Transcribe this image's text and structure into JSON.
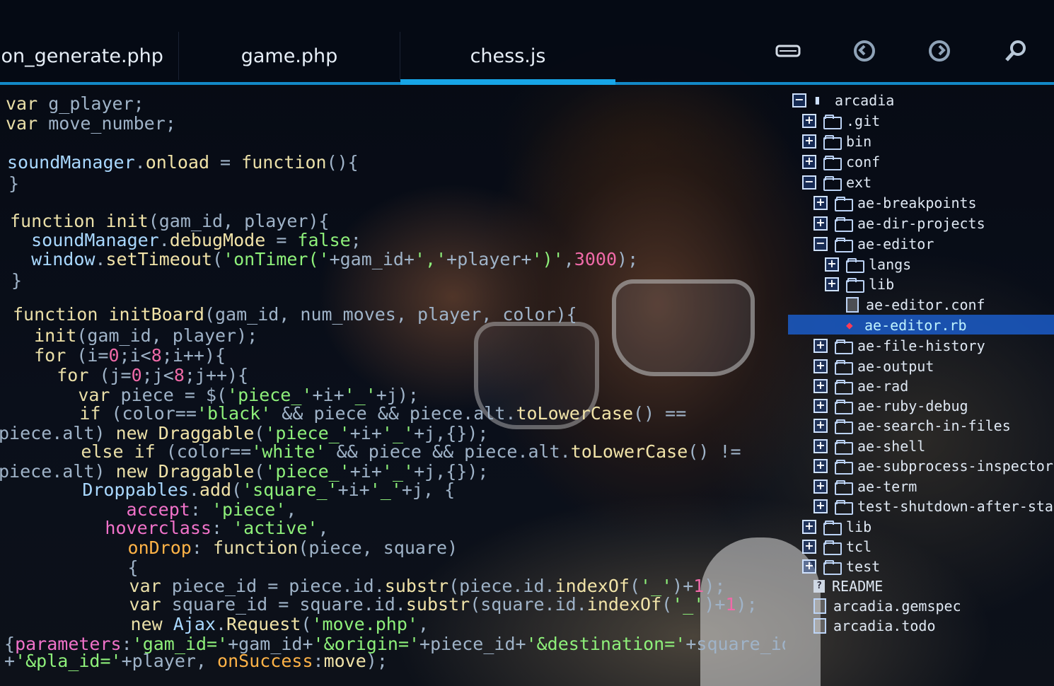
{
  "tabs": [
    "ion_generate.php",
    "game.php",
    "chess.js"
  ],
  "active_tab": "chess.js",
  "toolbar": {
    "icons": [
      "drive-icon",
      "undo-icon",
      "redo-icon",
      "search-icon"
    ]
  },
  "colors": {
    "accent": "#17a5e6",
    "selection": "#1b5cc8"
  },
  "code_lines": [
    [
      [
        "kw",
        "var "
      ],
      [
        "pl",
        "g_player;"
      ]
    ],
    [
      [
        "kw",
        "var "
      ],
      [
        "pl",
        "move_number;"
      ]
    ],
    [],
    [
      [
        "ob",
        "soundManager"
      ],
      [
        "pl",
        "."
      ],
      [
        "fn",
        "onload"
      ],
      [
        "pl",
        " = "
      ],
      [
        "kw",
        "function"
      ],
      [
        "pl",
        "(){"
      ]
    ],
    [
      [
        "pl",
        "}"
      ]
    ],
    [],
    [
      [
        "kw",
        "function "
      ],
      [
        "fn",
        "init"
      ],
      [
        "pl",
        "(gam_id, player){"
      ]
    ],
    [
      [
        "pl",
        "  "
      ],
      [
        "ob",
        "soundManager"
      ],
      [
        "pl",
        "."
      ],
      [
        "fn",
        "debugMode"
      ],
      [
        "pl",
        " = "
      ],
      [
        "st",
        "false"
      ],
      [
        "pl",
        ";"
      ]
    ],
    [
      [
        "pl",
        "  "
      ],
      [
        "ob",
        "window"
      ],
      [
        "pl",
        "."
      ],
      [
        "fn",
        "setTimeout"
      ],
      [
        "pl",
        "("
      ],
      [
        "st",
        "'onTimer('"
      ],
      [
        "pl",
        "+gam_id+"
      ],
      [
        "st",
        "','"
      ],
      [
        "pl",
        "+player+"
      ],
      [
        "st",
        "')'"
      ],
      [
        "pl",
        ","
      ],
      [
        "nm",
        "3000"
      ],
      [
        "pl",
        ");"
      ]
    ],
    [
      [
        "pl",
        "}"
      ]
    ],
    [],
    [
      [
        "kw",
        "function "
      ],
      [
        "fn",
        "initBoard"
      ],
      [
        "pl",
        "(gam_id, num_moves, player, color){"
      ]
    ],
    [
      [
        "pl",
        "  "
      ],
      [
        "fn",
        "init"
      ],
      [
        "pl",
        "(gam_id, player);"
      ]
    ],
    [
      [
        "pl",
        "  "
      ],
      [
        "kw",
        "for "
      ],
      [
        "pl",
        "(i="
      ],
      [
        "nm",
        "0"
      ],
      [
        "pl",
        ";i<"
      ],
      [
        "nm",
        "8"
      ],
      [
        "pl",
        ";i++){"
      ]
    ],
    [
      [
        "pl",
        "    "
      ],
      [
        "kw",
        "for "
      ],
      [
        "pl",
        "(j="
      ],
      [
        "nm",
        "0"
      ],
      [
        "pl",
        ";j<"
      ],
      [
        "nm",
        "8"
      ],
      [
        "pl",
        ";j++){"
      ]
    ],
    [
      [
        "pl",
        "      "
      ],
      [
        "kw",
        "var "
      ],
      [
        "pl",
        "piece = $("
      ],
      [
        "st",
        "'piece_'"
      ],
      [
        "pl",
        "+i+"
      ],
      [
        "st",
        "'_'"
      ],
      [
        "pl",
        "+j);"
      ]
    ],
    [
      [
        "pl",
        "      "
      ],
      [
        "kw",
        "if "
      ],
      [
        "pl",
        "(color=="
      ],
      [
        "st",
        "'black'"
      ],
      [
        "pl",
        " && piece && piece.alt."
      ],
      [
        "fn",
        "toLowerCase"
      ],
      [
        "pl",
        "() =="
      ]
    ],
    [
      [
        "pl",
        "piece.alt) "
      ],
      [
        "kw",
        "new "
      ],
      [
        "fn",
        "Draggable"
      ],
      [
        "pl",
        "("
      ],
      [
        "st",
        "'piece_'"
      ],
      [
        "pl",
        "+i+"
      ],
      [
        "st",
        "'_'"
      ],
      [
        "pl",
        "+j,{});"
      ]
    ],
    [
      [
        "pl",
        "      "
      ],
      [
        "kw",
        "else if "
      ],
      [
        "pl",
        "(color=="
      ],
      [
        "st",
        "'white'"
      ],
      [
        "pl",
        " && piece && piece.alt."
      ],
      [
        "fn",
        "toLowerCase"
      ],
      [
        "pl",
        "() !="
      ]
    ],
    [
      [
        "pl",
        "piece.alt) "
      ],
      [
        "kw",
        "new "
      ],
      [
        "fn",
        "Draggable"
      ],
      [
        "pl",
        "("
      ],
      [
        "st",
        "'piece_'"
      ],
      [
        "pl",
        "+i+"
      ],
      [
        "st",
        "'_'"
      ],
      [
        "pl",
        "+j,{});"
      ]
    ],
    [
      [
        "pl",
        "      "
      ],
      [
        "ob",
        "Droppables"
      ],
      [
        "pl",
        "."
      ],
      [
        "fn",
        "add"
      ],
      [
        "pl",
        "("
      ],
      [
        "st",
        "'square_'"
      ],
      [
        "pl",
        "+i+"
      ],
      [
        "st",
        "'_'"
      ],
      [
        "pl",
        "+j, {"
      ]
    ],
    [
      [
        "pl",
        "          "
      ],
      [
        "pk",
        "accept"
      ],
      [
        "pl",
        ": "
      ],
      [
        "st",
        "'piece'"
      ],
      [
        "pl",
        ","
      ]
    ],
    [
      [
        "pl",
        "        "
      ],
      [
        "pk",
        "hoverclass"
      ],
      [
        "pl",
        ": "
      ],
      [
        "st",
        "'active'"
      ],
      [
        "pl",
        ","
      ]
    ],
    [
      [
        "pl",
        "          "
      ],
      [
        "pr",
        "onDrop"
      ],
      [
        "pl",
        ": "
      ],
      [
        "kw",
        "function"
      ],
      [
        "pl",
        "(piece, square)"
      ]
    ],
    [
      [
        "pl",
        "          {"
      ]
    ],
    [
      [
        "pl",
        "          "
      ],
      [
        "kw",
        "var "
      ],
      [
        "pl",
        "piece_id = piece.id."
      ],
      [
        "fn",
        "substr"
      ],
      [
        "pl",
        "(piece.id."
      ],
      [
        "fn",
        "indexOf"
      ],
      [
        "pl",
        "("
      ],
      [
        "st",
        "'_'"
      ],
      [
        "pl",
        ")+"
      ],
      [
        "nm",
        "1"
      ],
      [
        "pl",
        ");"
      ]
    ],
    [
      [
        "pl",
        "          "
      ],
      [
        "kw",
        "var "
      ],
      [
        "pl",
        "square_id = square.id."
      ],
      [
        "fn",
        "substr"
      ],
      [
        "pl",
        "(square.id."
      ],
      [
        "fn",
        "indexOf"
      ],
      [
        "pl",
        "("
      ],
      [
        "st",
        "'_'"
      ],
      [
        "pl",
        ")+"
      ],
      [
        "nm",
        "1"
      ],
      [
        "pl",
        ");"
      ]
    ],
    [
      [
        "pl",
        "          "
      ],
      [
        "kw",
        "new "
      ],
      [
        "ob",
        "Ajax"
      ],
      [
        "pl",
        "."
      ],
      [
        "fn",
        "Request"
      ],
      [
        "pl",
        "("
      ],
      [
        "st",
        "'move.php'"
      ],
      [
        "pl",
        ","
      ]
    ],
    [
      [
        "pl",
        "{"
      ],
      [
        "pk",
        "parameters"
      ],
      [
        "pl",
        ":"
      ],
      [
        "st",
        "'gam_id='"
      ],
      [
        "pl",
        "+gam_id+"
      ],
      [
        "st",
        "'&origin='"
      ],
      [
        "pl",
        "+piece_id+"
      ],
      [
        "st",
        "'&destination='"
      ],
      [
        "pl",
        "+square_id"
      ]
    ],
    [
      [
        "pl",
        "+"
      ],
      [
        "st",
        "'&pla_id='"
      ],
      [
        "pl",
        "+player, "
      ],
      [
        "pr",
        "onSuccess"
      ],
      [
        "pl",
        ":"
      ],
      [
        "fn",
        "move"
      ],
      [
        "pl",
        ");"
      ]
    ]
  ],
  "tree": [
    {
      "label": "arcadia",
      "kind": "repo",
      "exp": "−",
      "depth": 0
    },
    {
      "label": ".git",
      "kind": "folder",
      "exp": "+",
      "depth": 1
    },
    {
      "label": "bin",
      "kind": "folder",
      "exp": "+",
      "depth": 1
    },
    {
      "label": "conf",
      "kind": "folder",
      "exp": "+",
      "depth": 1
    },
    {
      "label": "ext",
      "kind": "folder",
      "exp": "−",
      "depth": 1
    },
    {
      "label": "ae-breakpoints",
      "kind": "folder",
      "exp": "+",
      "depth": 2
    },
    {
      "label": "ae-dir-projects",
      "kind": "folder",
      "exp": "+",
      "depth": 2
    },
    {
      "label": "ae-editor",
      "kind": "folder",
      "exp": "−",
      "depth": 2
    },
    {
      "label": "langs",
      "kind": "folder",
      "exp": "+",
      "depth": 3
    },
    {
      "label": "lib",
      "kind": "folder",
      "exp": "+",
      "depth": 3
    },
    {
      "label": "ae-editor.conf",
      "kind": "file",
      "exp": "",
      "depth": 4
    },
    {
      "label": "ae-editor.rb",
      "kind": "ruby",
      "exp": "",
      "depth": 4,
      "selected": true
    },
    {
      "label": "ae-file-history",
      "kind": "folder",
      "exp": "+",
      "depth": 2
    },
    {
      "label": "ae-output",
      "kind": "folder",
      "exp": "+",
      "depth": 2
    },
    {
      "label": "ae-rad",
      "kind": "folder",
      "exp": "+",
      "depth": 2
    },
    {
      "label": "ae-ruby-debug",
      "kind": "folder",
      "exp": "+",
      "depth": 2
    },
    {
      "label": "ae-search-in-files",
      "kind": "folder",
      "exp": "+",
      "depth": 2
    },
    {
      "label": "ae-shell",
      "kind": "folder",
      "exp": "+",
      "depth": 2
    },
    {
      "label": "ae-subprocess-inspector",
      "kind": "folder",
      "exp": "+",
      "depth": 2
    },
    {
      "label": "ae-term",
      "kind": "folder",
      "exp": "+",
      "depth": 2
    },
    {
      "label": "test-shutdown-after-startu",
      "kind": "folder",
      "exp": "+",
      "depth": 2
    },
    {
      "label": "lib",
      "kind": "folder",
      "exp": "+",
      "depth": 1
    },
    {
      "label": "tcl",
      "kind": "folder",
      "exp": "+",
      "depth": 1
    },
    {
      "label": "test",
      "kind": "folder",
      "exp": "+",
      "depth": 1
    },
    {
      "label": "README",
      "kind": "readme",
      "exp": "",
      "depth": 2
    },
    {
      "label": "arcadia.gemspec",
      "kind": "file",
      "exp": "",
      "depth": 2
    },
    {
      "label": "arcadia.todo",
      "kind": "file",
      "exp": "",
      "depth": 2
    }
  ]
}
